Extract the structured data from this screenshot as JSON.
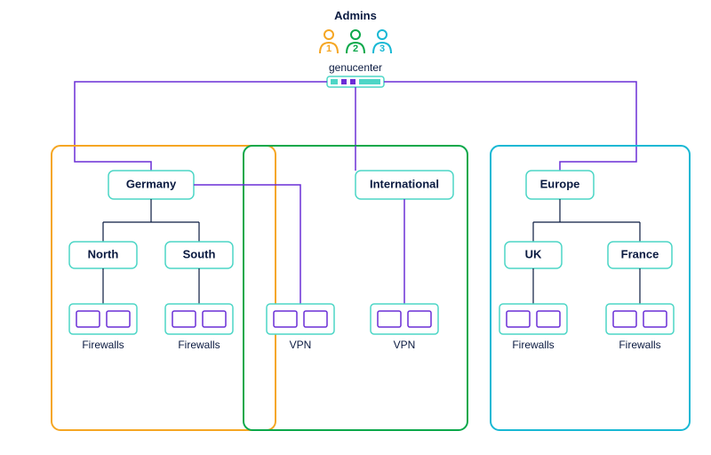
{
  "header": {
    "admins_label": "Admins",
    "genucenter_label": "genucenter"
  },
  "admins": [
    {
      "num": "1",
      "color": "#f5a623"
    },
    {
      "num": "2",
      "color": "#0ba84a"
    },
    {
      "num": "3",
      "color": "#18b8d4"
    }
  ],
  "zones": {
    "orange": {
      "root": "Germany",
      "children": [
        "North",
        "South"
      ],
      "devices": [
        "Firewalls",
        "Firewalls"
      ]
    },
    "green": {
      "root": "International",
      "devices": [
        "VPN",
        "VPN"
      ]
    },
    "cyan": {
      "root": "Europe",
      "children": [
        "UK",
        "France"
      ],
      "devices": [
        "Firewalls",
        "Firewalls"
      ]
    }
  },
  "colors": {
    "purple": "#6a2fd6",
    "teal": "#4dd6c6",
    "navy": "#0a1a40",
    "orange": "#f5a623",
    "green": "#0ba84a",
    "cyan": "#18b8d4"
  }
}
